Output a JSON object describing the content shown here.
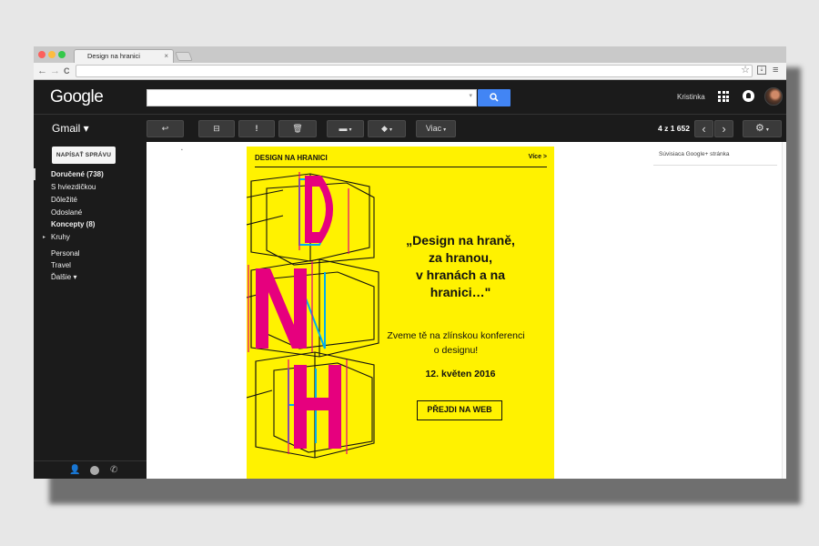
{
  "browser": {
    "tab_title": "Design na hranici",
    "tab_close": "×",
    "back": "←",
    "forward": "→",
    "reload": "C",
    "star": "☆",
    "menu": "≡"
  },
  "gmail": {
    "logo": "Google",
    "search_button_icon": "search-icon",
    "user_name": "Kristinka",
    "label": "Gmail ▾",
    "pagination": "4 z 1 652",
    "prev": "‹",
    "next": "›",
    "toolbar": {
      "reply": "↩",
      "archive": "⊟",
      "spam": "!",
      "delete": "🗑",
      "folder": "▬",
      "label": "◆",
      "more": "Viac",
      "settings": "⚙"
    },
    "compose": "NAPÍSAŤ SPRÁVU",
    "nav": [
      {
        "label": "Doručené (738)",
        "bold": true
      },
      {
        "label": "S hviezdičkou",
        "bold": false
      },
      {
        "label": "Dôležité",
        "bold": false
      },
      {
        "label": "Odoslané",
        "bold": false
      },
      {
        "label": "Koncepty (8)",
        "bold": true
      },
      {
        "label": "Kruhy",
        "bold": false
      },
      {
        "label": "Personal",
        "bold": false
      },
      {
        "label": "Travel",
        "bold": false
      },
      {
        "label": "Ďalšie ▾",
        "bold": false
      }
    ],
    "bottom_icons": [
      "person-icon",
      "hangouts-icon",
      "phone-icon"
    ],
    "related_page": "Súvisiaca Google+ stránka"
  },
  "email": {
    "header_title": "DESIGN NA HRANICI",
    "header_more": "Více >",
    "quote": "„Design na hraně,\nza hranou,\nv hranách a na\nhranici…\"",
    "invite": "Zveme tě na zlínskou konferenci\no designu!",
    "date": "12. květen 2016",
    "cta": "PŘEJDI NA WEB",
    "art_letters": [
      "D",
      "N",
      "H"
    ],
    "colors": {
      "background": "#fff200",
      "magenta": "#e6007e",
      "cyan": "#00aeef",
      "ink": "#111111"
    }
  }
}
